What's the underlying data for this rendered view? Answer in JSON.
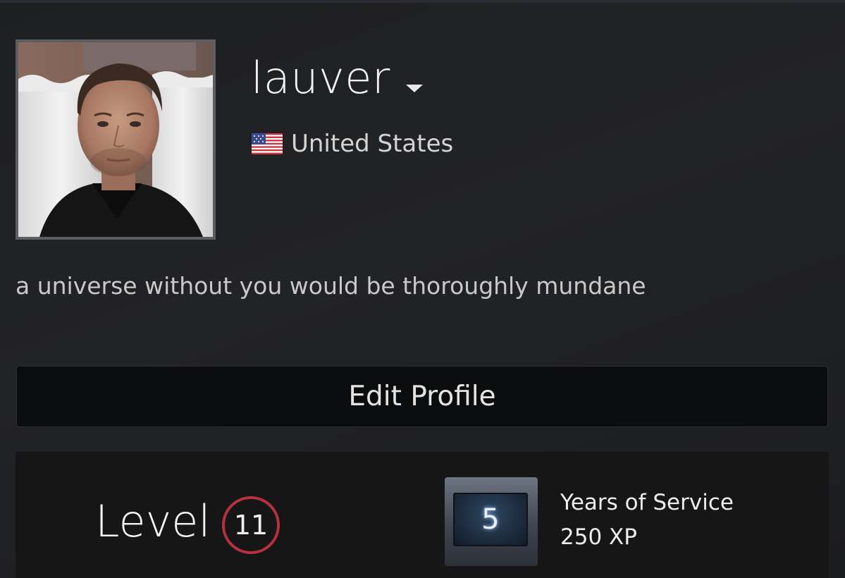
{
  "profile": {
    "persona_name": "lauver",
    "location": "United States",
    "summary": "a universe without you would be thoroughly mundane",
    "edit_button_label": "Edit Profile"
  },
  "level": {
    "label": "Level",
    "value": "11",
    "ring_color": "#b5313d"
  },
  "badge": {
    "number": "5",
    "name": "Years of Service",
    "xp": "250 XP"
  },
  "icons": {
    "flag": "us-flag-icon",
    "dropdown": "caret-down-icon"
  }
}
